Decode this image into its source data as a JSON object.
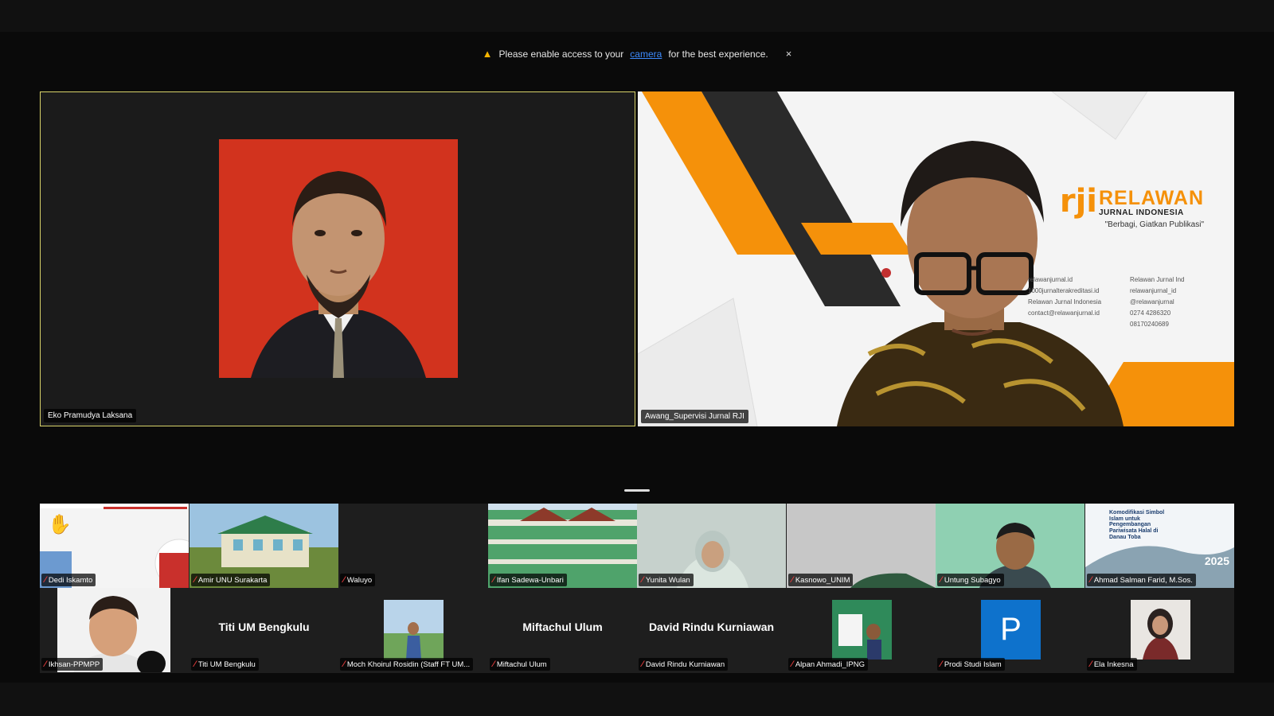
{
  "notice": {
    "prefix": "Please enable access to your",
    "link": "camera",
    "suffix": "for the best experience.",
    "close": "×"
  },
  "speakers": [
    {
      "name": "Eko Pramudya Laksana"
    },
    {
      "name": "Awang_Supervisi Jurnal RJI"
    }
  ],
  "banner": {
    "logo": "rji",
    "title": "RELAWAN",
    "subtitle": "JURNAL INDONESIA",
    "tagline": "\"Berbagi, Giatkan Publikasi\"",
    "contacts": [
      "relawanjurnal.id",
      "Relawan Jurnal Ind",
      "1000jurnalterakreditasi.id",
      "relawanjurnal_id",
      "Relawan Jurnal Indonesia",
      "@relawanjurnal",
      "contact@relawanjurnal.id",
      "0274 4286320",
      "",
      "08170240689"
    ]
  },
  "gallery_row1": [
    {
      "name": "Dedi Iskamto",
      "hand": "✋"
    },
    {
      "name": "Amir UNU Surakarta"
    },
    {
      "name": "Waluyo"
    },
    {
      "name": "Ifan Sadewa-Unbari"
    },
    {
      "name": "Yunita Wulan"
    },
    {
      "name": "Kasnowo_UNIM"
    },
    {
      "name": "Untung Subagyo"
    },
    {
      "name": "Ahmad Salman Farid, M.Sos.",
      "slide_title": "Komodifikasi Simbol Islam untuk Pengembangan Pariwisata Halal di Danau Toba",
      "slide_year": "2025"
    }
  ],
  "gallery_row2": [
    {
      "name": "Ikhsan-PPMPP"
    },
    {
      "name": "Titi UM Bengkulu",
      "center": "Titi UM Bengkulu"
    },
    {
      "name": "Moch Khoirul Rosidin (Staff FT UM..."
    },
    {
      "name": "Miftachul Ulum",
      "center": "Miftachul Ulum"
    },
    {
      "name": "David Rindu Kurniawan",
      "center": "David Rindu Kurniawan"
    },
    {
      "name": "Alpan Ahmadi_IPNG"
    },
    {
      "name": "Prodi Studi Islam",
      "avatar_letter": "P"
    },
    {
      "name": "Ela Inkesna"
    }
  ],
  "colors": {
    "accent_orange": "#f5910a",
    "active_border": "#d9d36a",
    "link": "#3d8bfd"
  }
}
